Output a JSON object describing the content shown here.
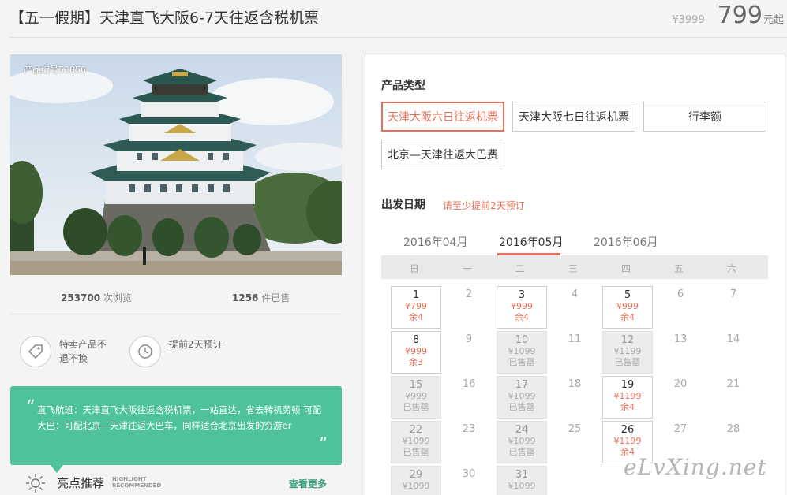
{
  "header": {
    "title": "【五一假期】天津直飞大阪6-7天往返含税机票",
    "old_price": "¥3999",
    "price": "799",
    "price_unit": "元起"
  },
  "hero": {
    "product_no": "产品编号53856",
    "image_subject": "Osaka Castle"
  },
  "stats": {
    "views_count": "253700",
    "views_label": " 次浏览",
    "sold_count": "1256",
    "sold_label": " 件已售"
  },
  "features": [
    {
      "icon": "tag-icon",
      "text": "特卖产品不退不换"
    },
    {
      "icon": "clock-icon",
      "text": "提前2天预订"
    }
  ],
  "quote": {
    "text": "直飞航班：天津直飞大阪往返含税机票，一站直达，省去转机劳顿 可配大巴：可配北京—天津往返大巴车，同样适合北京出发的穷游er"
  },
  "highlight": {
    "title": "亮点推荐",
    "sub1": "HIGHLIGHT",
    "sub2": "RECOMMENDED",
    "more": "查看更多"
  },
  "panel": {
    "type_label": "产品类型",
    "types": [
      {
        "label": "天津大阪六日往返机票",
        "active": true
      },
      {
        "label": "天津大阪七日往返机票",
        "active": false
      },
      {
        "label": "行李额",
        "active": false
      },
      {
        "label": "北京—天津往返大巴费",
        "active": false
      }
    ],
    "date_label": "出发日期",
    "notice": "请至少提前2天预订",
    "months": [
      "2016年04月",
      "2016年05月",
      "2016年06月"
    ],
    "active_month": 1,
    "weekdays": [
      "日",
      "一",
      "二",
      "三",
      "四",
      "五",
      "六"
    ]
  },
  "calendar": [
    {
      "day": "1",
      "status": "avail",
      "price": "¥799",
      "stock": "余4"
    },
    {
      "day": "2",
      "status": "plain"
    },
    {
      "day": "3",
      "status": "avail",
      "price": "¥999",
      "stock": "余4"
    },
    {
      "day": "4",
      "status": "plain"
    },
    {
      "day": "5",
      "status": "avail",
      "price": "¥999",
      "stock": "余4"
    },
    {
      "day": "6",
      "status": "plain"
    },
    {
      "day": "7",
      "status": "plain"
    },
    {
      "day": "8",
      "status": "avail",
      "price": "¥999",
      "stock": "余3"
    },
    {
      "day": "9",
      "status": "plain"
    },
    {
      "day": "10",
      "status": "sold",
      "price": "¥1099",
      "stock": "已售罄"
    },
    {
      "day": "11",
      "status": "plain"
    },
    {
      "day": "12",
      "status": "sold",
      "price": "¥1199",
      "stock": "已售罄"
    },
    {
      "day": "13",
      "status": "plain"
    },
    {
      "day": "14",
      "status": "plain"
    },
    {
      "day": "15",
      "status": "sold",
      "price": "¥999",
      "stock": "已售罄"
    },
    {
      "day": "16",
      "status": "plain"
    },
    {
      "day": "17",
      "status": "sold",
      "price": "¥1099",
      "stock": "已售罄"
    },
    {
      "day": "18",
      "status": "plain"
    },
    {
      "day": "19",
      "status": "avail",
      "price": "¥1199",
      "stock": "余4"
    },
    {
      "day": "20",
      "status": "plain"
    },
    {
      "day": "21",
      "status": "plain"
    },
    {
      "day": "22",
      "status": "sold",
      "price": "¥1099",
      "stock": "已售罄"
    },
    {
      "day": "23",
      "status": "plain"
    },
    {
      "day": "24",
      "status": "sold",
      "price": "¥1099",
      "stock": "已售罄"
    },
    {
      "day": "25",
      "status": "plain"
    },
    {
      "day": "26",
      "status": "avail",
      "price": "¥1199",
      "stock": "余4"
    },
    {
      "day": "27",
      "status": "plain"
    },
    {
      "day": "28",
      "status": "plain"
    },
    {
      "day": "29",
      "status": "sold",
      "price": "¥1099",
      "stock": ""
    },
    {
      "day": "30",
      "status": "plain"
    },
    {
      "day": "31",
      "status": "sold",
      "price": "¥1099",
      "stock": ""
    }
  ],
  "watermark": "eLvXing.net",
  "colors": {
    "accent": "#e8705a",
    "green": "#4dc29d",
    "link_green": "#3aa07c"
  }
}
